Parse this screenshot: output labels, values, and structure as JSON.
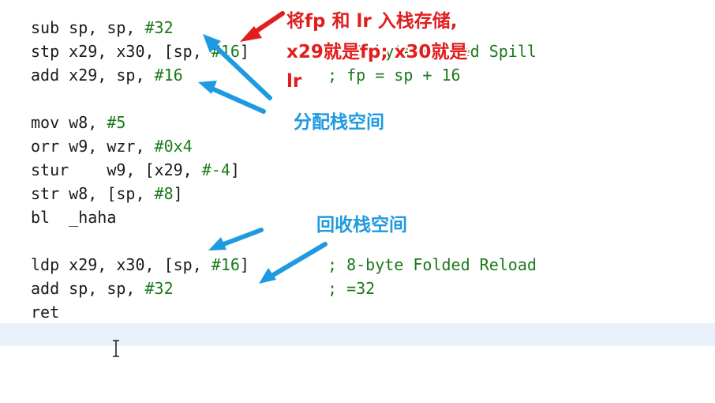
{
  "code": {
    "lines": [
      {
        "code": "sub sp, sp, #32",
        "imm": "#32",
        "comment": ""
      },
      {
        "code": "stp x29, x30, [sp, #16]",
        "imm": "#16",
        "comment": "; 16-byte Folded Spill"
      },
      {
        "code": "add x29, sp, #16",
        "imm": "#16",
        "comment": "; fp = sp + 16"
      },
      {
        "code": "",
        "imm": "",
        "comment": ""
      },
      {
        "code": "mov w8, #5",
        "imm": "#5",
        "comment": ""
      },
      {
        "code": "orr w9, wzr, #0x4",
        "imm": "#0x4",
        "comment": ""
      },
      {
        "code": "stur    w9, [x29, #-4]",
        "imm": "#-4",
        "comment": ""
      },
      {
        "code": "str w8, [sp, #8]",
        "imm": "#8",
        "comment": ""
      },
      {
        "code": "bl  _haha",
        "imm": "",
        "comment": ""
      },
      {
        "code": "",
        "imm": "",
        "comment": ""
      },
      {
        "code": "ldp x29, x30, [sp, #16]",
        "imm": "#16",
        "comment": "; 8-byte Folded Reload"
      },
      {
        "code": "add sp, sp, #32",
        "imm": "#32",
        "comment": "; =32"
      },
      {
        "code": "ret",
        "imm": "",
        "comment": ""
      }
    ]
  },
  "annotations": {
    "push_note_line1": "将fp 和 lr 入栈存储,",
    "push_note_line2": "x29就是fp; x30就是",
    "push_note_line3": "lr",
    "alloc_note": "分配栈空间",
    "free_note": "回收栈空间"
  },
  "colors": {
    "red_annotation": "#e01e1e",
    "blue_annotation": "#1e9ae0",
    "comment": "#1a7a1a",
    "current_line": "#e9f1fb"
  }
}
